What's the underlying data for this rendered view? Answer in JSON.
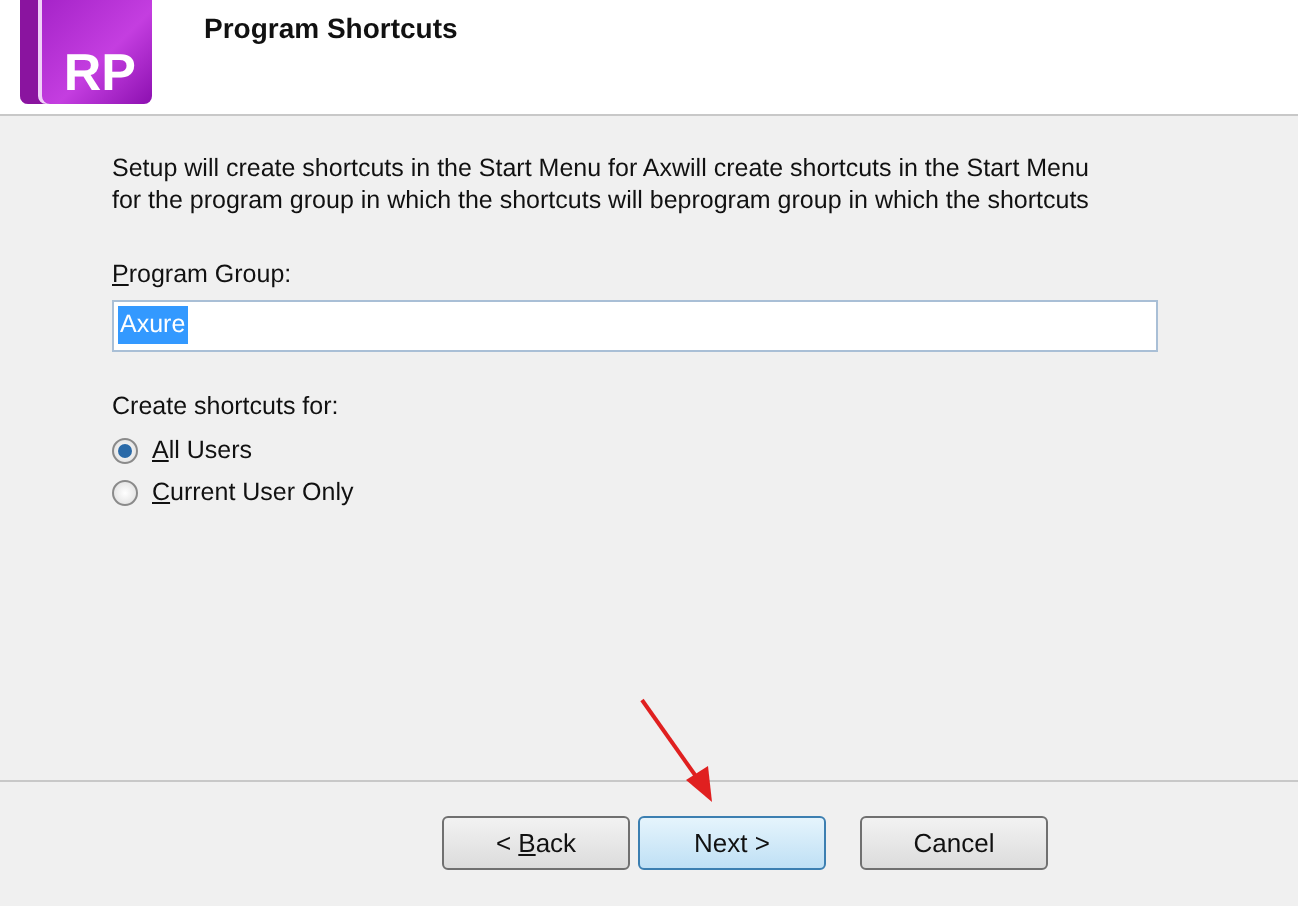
{
  "header": {
    "logo": "RP",
    "title": "Program Shortcuts"
  },
  "description": [
    "Setup will create shortcuts in the Start Menu for Axwill create shortcuts in the Start Menu",
    "for the program group in which the shortcuts will beprogram group in which the shortcuts"
  ],
  "program_group": {
    "label": {
      "access_key": "P",
      "after": "rogram Group:"
    },
    "value": "Axure",
    "text_selected": true
  },
  "shortcuts_for": {
    "label": "Create shortcuts for:",
    "options": [
      {
        "label": {
          "access_key": "A",
          "after": "ll Users"
        },
        "selected": true
      },
      {
        "label": {
          "access_key": "C",
          "after": "urrent User Only"
        },
        "selected": false
      }
    ]
  },
  "buttons": [
    {
      "label": {
        "before": "< ",
        "access_key": "B",
        "after": "ack"
      },
      "default": false
    },
    {
      "label": {
        "before": "Next >"
      },
      "default": true
    },
    {
      "label": {
        "before": "Cancel"
      },
      "default": false
    }
  ]
}
